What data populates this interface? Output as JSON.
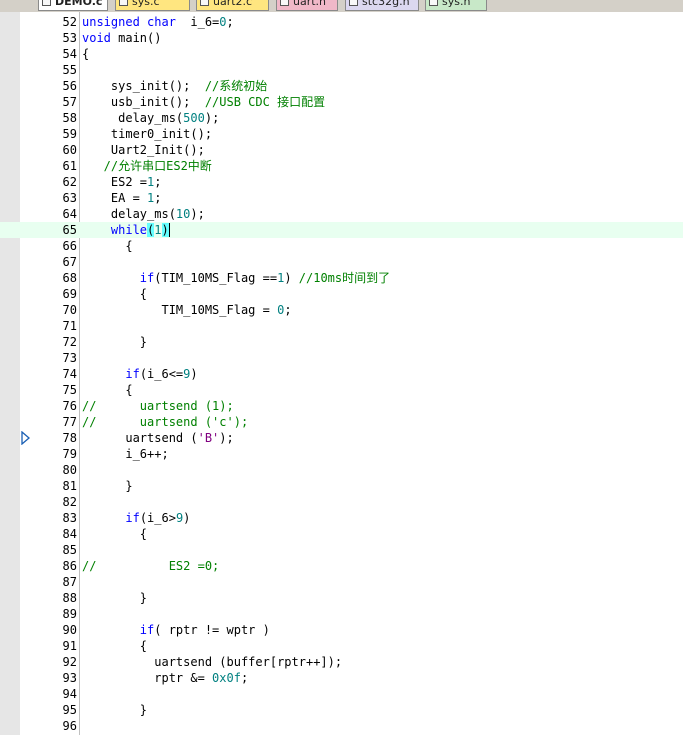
{
  "tabs": [
    {
      "label": "DEMO.c",
      "active": true
    },
    {
      "label": "sys.c",
      "active": false
    },
    {
      "label": "uart2.c",
      "active": false
    },
    {
      "label": "uart.h",
      "active": false
    },
    {
      "label": "stc32g.h",
      "active": false
    },
    {
      "label": "sys.h",
      "active": false
    }
  ],
  "editor": {
    "current_line": 65,
    "execution_marker_line": 78,
    "icons": {
      "execution_marker": "current-position-arrow-icon",
      "tab_file": "file-icon"
    },
    "colors": {
      "keyword": "#0000ff",
      "comment": "#008000",
      "number": "#008080",
      "string": "#800080",
      "bracket_match": "#66ffff",
      "current_line_bg": "#e8fff0"
    },
    "lines": [
      {
        "n": 52,
        "segs": [
          [
            "kw",
            "unsigned char"
          ],
          [
            "",
            "  i_6="
          ],
          [
            "num",
            "0"
          ],
          [
            "",
            ";"
          ]
        ]
      },
      {
        "n": 53,
        "segs": [
          [
            "kw",
            "void"
          ],
          [
            "",
            " main()"
          ]
        ]
      },
      {
        "n": 54,
        "segs": [
          [
            "",
            "{"
          ]
        ]
      },
      {
        "n": 55,
        "segs": []
      },
      {
        "n": 56,
        "segs": [
          [
            "",
            "    sys_init();  "
          ],
          [
            "cm",
            "//系统初始"
          ]
        ]
      },
      {
        "n": 57,
        "segs": [
          [
            "",
            "    usb_init();  "
          ],
          [
            "cm",
            "//USB CDC 接口配置"
          ]
        ]
      },
      {
        "n": 58,
        "segs": [
          [
            "",
            "     delay_ms("
          ],
          [
            "num",
            "500"
          ],
          [
            "",
            ");"
          ]
        ]
      },
      {
        "n": 59,
        "segs": [
          [
            "",
            "    timer0_init();"
          ]
        ]
      },
      {
        "n": 60,
        "segs": [
          [
            "",
            "    Uart2_Init();"
          ]
        ]
      },
      {
        "n": 61,
        "segs": [
          [
            "cm",
            "   //允许串口ES2中断"
          ]
        ]
      },
      {
        "n": 62,
        "segs": [
          [
            "",
            "    ES2 ="
          ],
          [
            "num",
            "1"
          ],
          [
            "",
            ";"
          ]
        ]
      },
      {
        "n": 63,
        "segs": [
          [
            "",
            "    EA = "
          ],
          [
            "num",
            "1"
          ],
          [
            "",
            ";"
          ]
        ]
      },
      {
        "n": 64,
        "segs": [
          [
            "",
            "    delay_ms("
          ],
          [
            "num",
            "10"
          ],
          [
            "",
            ");"
          ]
        ]
      },
      {
        "n": 65,
        "segs": [
          [
            "",
            "    "
          ],
          [
            "kw",
            "while"
          ],
          [
            "hl",
            "("
          ],
          [
            "num",
            "1"
          ],
          [
            "hlc",
            ")"
          ]
        ]
      },
      {
        "n": 66,
        "segs": [
          [
            "",
            "      {"
          ]
        ]
      },
      {
        "n": 67,
        "segs": []
      },
      {
        "n": 68,
        "segs": [
          [
            "",
            "        "
          ],
          [
            "kw",
            "if"
          ],
          [
            "",
            "(TIM_10MS_Flag =="
          ],
          [
            "num",
            "1"
          ],
          [
            "",
            ") "
          ],
          [
            "cm",
            "//10ms时间到了"
          ]
        ]
      },
      {
        "n": 69,
        "segs": [
          [
            "",
            "        {"
          ]
        ]
      },
      {
        "n": 70,
        "segs": [
          [
            "",
            "           TIM_10MS_Flag = "
          ],
          [
            "num",
            "0"
          ],
          [
            "",
            ";"
          ]
        ]
      },
      {
        "n": 71,
        "segs": []
      },
      {
        "n": 72,
        "segs": [
          [
            "",
            "        }"
          ]
        ]
      },
      {
        "n": 73,
        "segs": []
      },
      {
        "n": 74,
        "segs": [
          [
            "",
            "      "
          ],
          [
            "kw",
            "if"
          ],
          [
            "",
            "(i_6<="
          ],
          [
            "num",
            "9"
          ],
          [
            "",
            ")"
          ]
        ]
      },
      {
        "n": 75,
        "segs": [
          [
            "",
            "      {"
          ]
        ]
      },
      {
        "n": 76,
        "segs": [
          [
            "cm",
            "//      uartsend (1);"
          ]
        ]
      },
      {
        "n": 77,
        "segs": [
          [
            "cm",
            "//      uartsend ('c');"
          ]
        ]
      },
      {
        "n": 78,
        "segs": [
          [
            "",
            "      uartsend ("
          ],
          [
            "str",
            "'B'"
          ],
          [
            "",
            ");"
          ]
        ]
      },
      {
        "n": 79,
        "segs": [
          [
            "",
            "      i_6++;"
          ]
        ]
      },
      {
        "n": 80,
        "segs": []
      },
      {
        "n": 81,
        "segs": [
          [
            "",
            "      }"
          ]
        ]
      },
      {
        "n": 82,
        "segs": []
      },
      {
        "n": 83,
        "segs": [
          [
            "",
            "      "
          ],
          [
            "kw",
            "if"
          ],
          [
            "",
            "(i_6>"
          ],
          [
            "num",
            "9"
          ],
          [
            "",
            ")"
          ]
        ]
      },
      {
        "n": 84,
        "segs": [
          [
            "",
            "        {"
          ]
        ]
      },
      {
        "n": 85,
        "segs": []
      },
      {
        "n": 86,
        "segs": [
          [
            "cm",
            "//          ES2 =0;"
          ]
        ]
      },
      {
        "n": 87,
        "segs": []
      },
      {
        "n": 88,
        "segs": [
          [
            "",
            "        }"
          ]
        ]
      },
      {
        "n": 89,
        "segs": []
      },
      {
        "n": 90,
        "segs": [
          [
            "",
            "        "
          ],
          [
            "kw",
            "if"
          ],
          [
            "",
            "( rptr != wptr )"
          ]
        ]
      },
      {
        "n": 91,
        "segs": [
          [
            "",
            "        {"
          ]
        ]
      },
      {
        "n": 92,
        "segs": [
          [
            "",
            "          uartsend (buffer[rptr++]);"
          ]
        ]
      },
      {
        "n": 93,
        "segs": [
          [
            "",
            "          rptr &= "
          ],
          [
            "num",
            "0x0f"
          ],
          [
            "",
            ";"
          ]
        ]
      },
      {
        "n": 94,
        "segs": []
      },
      {
        "n": 95,
        "segs": [
          [
            "",
            "        }"
          ]
        ]
      },
      {
        "n": 96,
        "segs": []
      }
    ]
  }
}
